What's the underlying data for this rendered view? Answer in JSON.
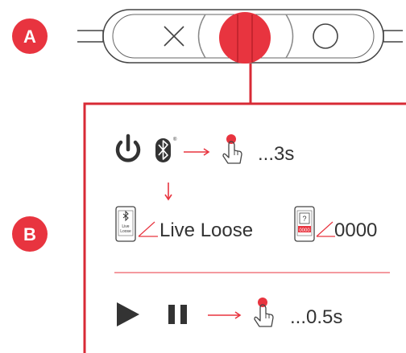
{
  "markers": {
    "a_label": "A",
    "b_label": "B"
  },
  "colors": {
    "accent": "#e8343f",
    "line": "#d82a35",
    "dark": "#333333",
    "gray": "#555555"
  },
  "remote": {
    "buttons": [
      {
        "name": "cross-icon"
      },
      {
        "name": "center-button"
      },
      {
        "name": "circle-icon"
      }
    ]
  },
  "step_pairing": {
    "icons": [
      "power-icon",
      "bluetooth-icon",
      "arrow-right-icon",
      "finger-press-icon"
    ],
    "duration": "...3s"
  },
  "step_device": {
    "phone_bt_small_text": "Live\nLoose",
    "device_name": "Live Loose",
    "phone_q_small_text": "0000",
    "phone_q_mark": "?",
    "pin": "0000"
  },
  "step_play": {
    "icons": [
      "play-icon",
      "pause-icon",
      "arrow-right-icon",
      "finger-press-icon"
    ],
    "duration": "...0.5s"
  }
}
